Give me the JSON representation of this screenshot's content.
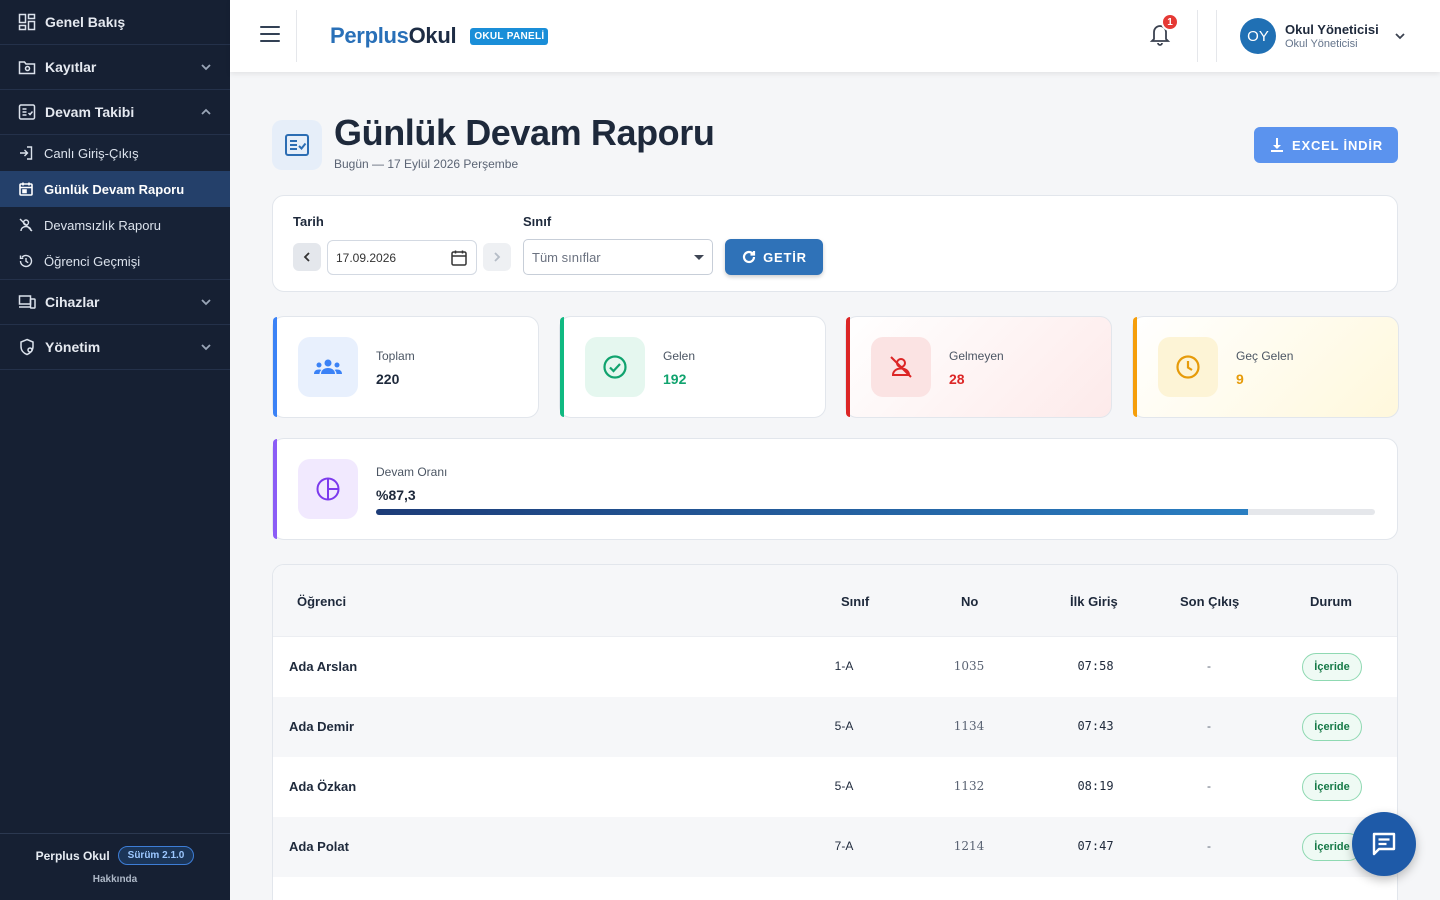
{
  "sidebar": {
    "items": [
      {
        "label": "Genel Bakış",
        "icon": "dashboard-icon"
      },
      {
        "label": "Kayıtlar",
        "icon": "folder-icon"
      },
      {
        "label": "Devam Takibi",
        "icon": "checklist-icon"
      },
      {
        "label": "Cihazlar",
        "icon": "devices-icon"
      },
      {
        "label": "Yönetim",
        "icon": "settings-icon"
      }
    ],
    "devam_subitems": [
      {
        "label": "Canlı Giriş-Çıkış",
        "icon": "login-icon"
      },
      {
        "label": "Günlük Devam Raporu",
        "icon": "calendar-icon"
      },
      {
        "label": "Devamsızlık Raporu",
        "icon": "person-off-icon"
      },
      {
        "label": "Öğrenci Geçmişi",
        "icon": "history-icon"
      }
    ],
    "footer": {
      "app_name": "Perplus Okul",
      "version": "Sürüm 2.1.0",
      "about": "Hakkında"
    }
  },
  "header": {
    "brand_part1": "Perplus",
    "brand_part2": "Okul",
    "panel_badge": "OKUL PANELİ",
    "notification_count": "1",
    "avatar_initials": "OY",
    "user_name": "Okul Yöneticisi",
    "user_role": "Okul Yöneticisi"
  },
  "page": {
    "title": "Günlük Devam Raporu",
    "subtitle": "Bugün — 17 Eylül 2026 Perşembe",
    "excel_button": "EXCEL İNDİR"
  },
  "filters": {
    "date_label": "Tarih",
    "date_value": "17.09.2026",
    "class_label": "Sınıf",
    "class_placeholder": "Tüm sınıflar",
    "fetch_button": "GETİR"
  },
  "stats": [
    {
      "label": "Toplam",
      "value": "220",
      "color": "#3b82f6"
    },
    {
      "label": "Gelen",
      "value": "192",
      "color": "#10b981"
    },
    {
      "label": "Gelmeyen",
      "value": "28",
      "color": "#dc2626"
    },
    {
      "label": "Geç Gelen",
      "value": "9",
      "color": "#f59e0b"
    }
  ],
  "rate": {
    "label": "Devam Oranı",
    "value": "%87,3",
    "percent": 87.3
  },
  "table": {
    "headers": {
      "student": "Öğrenci",
      "class": "Sınıf",
      "no": "No",
      "first_in": "İlk Giriş",
      "last_out": "Son Çıkış",
      "status": "Durum"
    },
    "rows": [
      {
        "name": "Ada Arslan",
        "class": "1-A",
        "no": "1035",
        "first_in": "07:58",
        "last_out": "-",
        "status": "İçeride"
      },
      {
        "name": "Ada Demir",
        "class": "5-A",
        "no": "1134",
        "first_in": "07:43",
        "last_out": "-",
        "status": "İçeride"
      },
      {
        "name": "Ada Özkan",
        "class": "5-A",
        "no": "1132",
        "first_in": "08:19",
        "last_out": "-",
        "status": "İçeride"
      },
      {
        "name": "Ada Polat",
        "class": "7-A",
        "no": "1214",
        "first_in": "07:47",
        "last_out": "-",
        "status": "İçeride"
      }
    ]
  },
  "colors": {
    "sidebar_bg": "#162033",
    "accent": "#2f72b8",
    "active_item": "#24406a"
  }
}
